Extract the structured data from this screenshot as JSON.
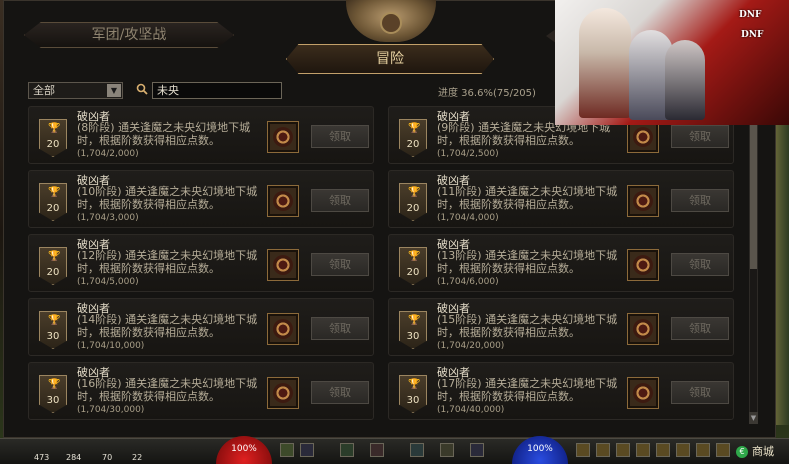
{
  "tabs": {
    "left_label": "军团/攻坚战",
    "active_label": "冒险"
  },
  "filter": {
    "category_value": "全部",
    "search_value": "未央"
  },
  "progress_text": "进度 36.6%(75/205)",
  "achievements": [
    {
      "title": "破凶者",
      "desc": "(8阶段) 通关逢魔之未央幻境地下城时，根据阶数获得相应点数。",
      "progress": "(1,704/2,000)",
      "points": "20",
      "claim_label": "领取"
    },
    {
      "title": "破凶者",
      "desc": "(9阶段) 通关逢魔之未央幻境地下城时，根据阶数获得相应点数。",
      "progress": "(1,704/2,500)",
      "points": "20",
      "claim_label": "领取"
    },
    {
      "title": "破凶者",
      "desc": "(10阶段) 通关逢魔之未央幻境地下城时，根据阶数获得相应点数。",
      "progress": "(1,704/3,000)",
      "points": "20",
      "claim_label": "领取"
    },
    {
      "title": "破凶者",
      "desc": "(11阶段) 通关逢魔之未央幻境地下城时，根据阶数获得相应点数。",
      "progress": "(1,704/4,000)",
      "points": "20",
      "claim_label": "领取"
    },
    {
      "title": "破凶者",
      "desc": "(12阶段) 通关逢魔之未央幻境地下城时，根据阶数获得相应点数。",
      "progress": "(1,704/5,000)",
      "points": "20",
      "claim_label": "领取"
    },
    {
      "title": "破凶者",
      "desc": "(13阶段) 通关逢魔之未央幻境地下城时，根据阶数获得相应点数。",
      "progress": "(1,704/6,000)",
      "points": "20",
      "claim_label": "领取"
    },
    {
      "title": "破凶者",
      "desc": "(14阶段) 通关逢魔之未央幻境地下城时，根据阶数获得相应点数。",
      "progress": "(1,704/10,000)",
      "points": "30",
      "claim_label": "领取"
    },
    {
      "title": "破凶者",
      "desc": "(15阶段) 通关逢魔之未央幻境地下城时，根据阶数获得相应点数。",
      "progress": "(1,704/20,000)",
      "points": "30",
      "claim_label": "领取"
    },
    {
      "title": "破凶者",
      "desc": "(16阶段) 通关逢魔之未央幻境地下城时，根据阶数获得相应点数。",
      "progress": "(1,704/30,000)",
      "points": "30",
      "claim_label": "领取"
    },
    {
      "title": "破凶者",
      "desc": "(17阶段) 通关逢魔之未央幻境地下城时，根据阶数获得相应点数。",
      "progress": "(1,704/40,000)",
      "points": "30",
      "claim_label": "领取"
    }
  ],
  "hud": {
    "hp_text": "100%",
    "mp_text": "100%",
    "stat_a": "473",
    "stat_b": "284",
    "stat_c": "70",
    "stat_d": "22",
    "shop_label": "商城"
  },
  "icons": {
    "search": "search-icon",
    "trophy": "trophy-icon",
    "reward": "reward-box-icon",
    "dropdown": "chevron-down-icon"
  },
  "colors": {
    "accent_gold": "#c2a06a",
    "hp_red": "#e02020",
    "mp_blue": "#2a4ce0"
  }
}
